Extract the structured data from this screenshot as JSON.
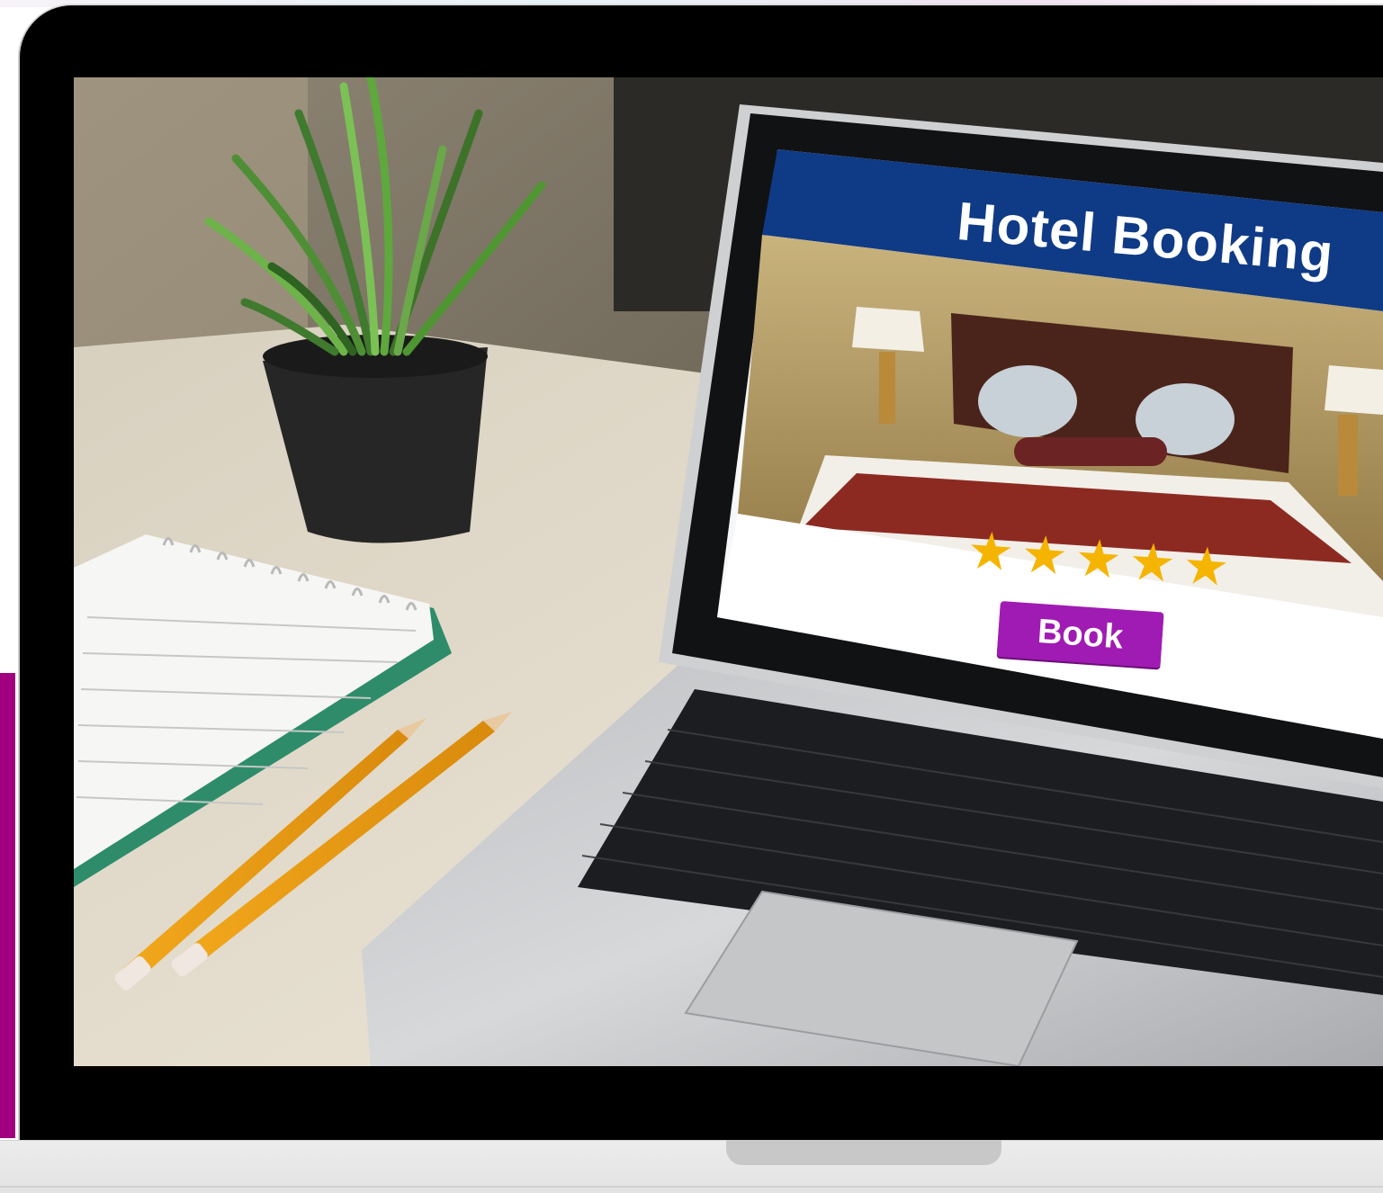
{
  "screen": {
    "title": "Hotel Booking",
    "rating_stars": 5,
    "star_glyph": "★",
    "button_label": "Book"
  },
  "colors": {
    "accent_magenta": "#a0007f",
    "header_blue": "#0f3a86",
    "button_purple": "#a01bb3",
    "star_gold": "#f5b400"
  }
}
